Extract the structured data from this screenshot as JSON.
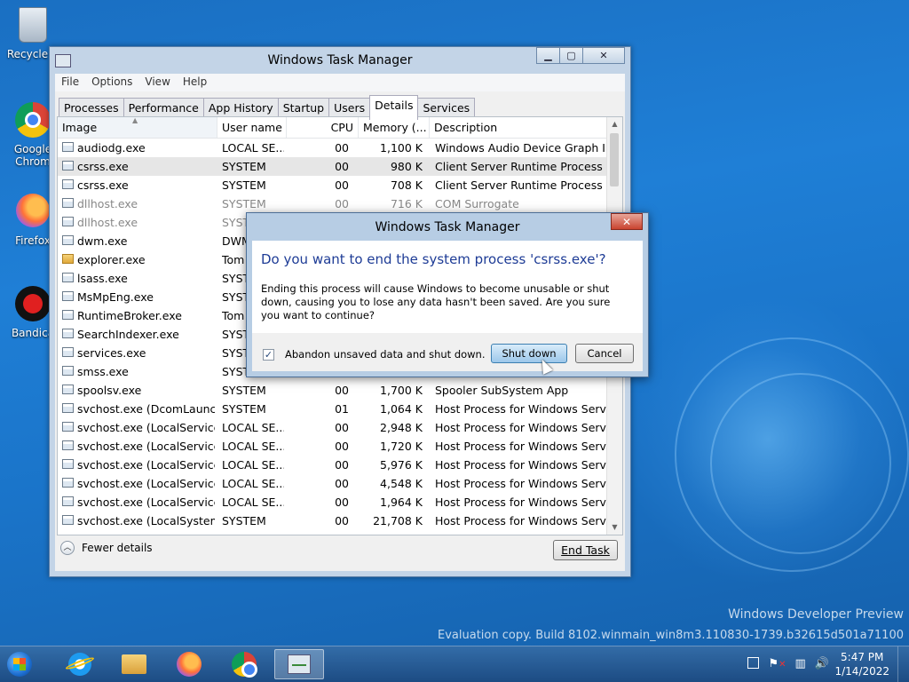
{
  "desktop": {
    "icons": [
      {
        "label": "Recycle B"
      },
      {
        "label": "Google Chrom"
      },
      {
        "label": "Firefox"
      },
      {
        "label": "Bandica"
      }
    ],
    "watermark_line1": "Windows Developer Preview",
    "watermark_line2": "Evaluation copy. Build 8102.winmain_win8m3.110830-1739.b32615d501a71100"
  },
  "task_manager": {
    "title": "Windows Task Manager",
    "caption": {
      "minimize": "▁",
      "maximize": "▢",
      "close": "✕"
    },
    "menu": [
      "File",
      "Options",
      "View",
      "Help"
    ],
    "tabs": [
      "Processes",
      "Performance",
      "App History",
      "Startup",
      "Users",
      "Details",
      "Services"
    ],
    "active_tab": "Details",
    "columns": {
      "image": "Image",
      "user": "User name",
      "cpu": "CPU",
      "memory": "Memory (...",
      "description": "Description"
    },
    "rows": [
      {
        "image": "audiodg.exe",
        "user": "LOCAL SE...",
        "cpu": "00",
        "memory": "1,100 K",
        "description": "Windows Audio Device Graph I..."
      },
      {
        "image": "csrss.exe",
        "user": "SYSTEM",
        "cpu": "00",
        "memory": "980 K",
        "description": "Client Server Runtime Process"
      },
      {
        "image": "csrss.exe",
        "user": "SYSTEM",
        "cpu": "00",
        "memory": "708 K",
        "description": "Client Server Runtime Process"
      },
      {
        "image": "dllhost.exe",
        "user": "SYSTEM",
        "cpu": "00",
        "memory": "716 K",
        "description": "COM Surrogate"
      },
      {
        "image": "dllhost.exe",
        "user": "SYST",
        "cpu": "",
        "memory": "",
        "description": ""
      },
      {
        "image": "dwm.exe",
        "user": "DWM",
        "cpu": "",
        "memory": "",
        "description": ""
      },
      {
        "image": "explorer.exe",
        "user": "Tom",
        "cpu": "",
        "memory": "",
        "description": ""
      },
      {
        "image": "lsass.exe",
        "user": "SYST",
        "cpu": "",
        "memory": "",
        "description": ""
      },
      {
        "image": "MsMpEng.exe",
        "user": "SYST",
        "cpu": "",
        "memory": "",
        "description": ""
      },
      {
        "image": "RuntimeBroker.exe",
        "user": "Tom",
        "cpu": "",
        "memory": "",
        "description": ""
      },
      {
        "image": "SearchIndexer.exe",
        "user": "SYST",
        "cpu": "",
        "memory": "",
        "description": ""
      },
      {
        "image": "services.exe",
        "user": "SYST",
        "cpu": "",
        "memory": "",
        "description": ""
      },
      {
        "image": "smss.exe",
        "user": "SYST",
        "cpu": "",
        "memory": "",
        "description": ""
      },
      {
        "image": "spoolsv.exe",
        "user": "SYSTEM",
        "cpu": "00",
        "memory": "1,700 K",
        "description": "Spooler SubSystem App"
      },
      {
        "image": "svchost.exe (DcomLaunch)",
        "user": "SYSTEM",
        "cpu": "01",
        "memory": "1,064 K",
        "description": "Host Process for Windows Serv..."
      },
      {
        "image": "svchost.exe (LocalService)",
        "user": "LOCAL SE...",
        "cpu": "00",
        "memory": "2,948 K",
        "description": "Host Process for Windows Serv..."
      },
      {
        "image": "svchost.exe (LocalService...",
        "user": "LOCAL SE...",
        "cpu": "00",
        "memory": "1,720 K",
        "description": "Host Process for Windows Serv..."
      },
      {
        "image": "svchost.exe (LocalService...",
        "user": "LOCAL SE...",
        "cpu": "00",
        "memory": "5,976 K",
        "description": "Host Process for Windows Serv..."
      },
      {
        "image": "svchost.exe (LocalService...",
        "user": "LOCAL SE...",
        "cpu": "00",
        "memory": "4,548 K",
        "description": "Host Process for Windows Serv..."
      },
      {
        "image": "svchost.exe (LocalService...",
        "user": "LOCAL SE...",
        "cpu": "00",
        "memory": "1,964 K",
        "description": "Host Process for Windows Serv..."
      },
      {
        "image": "svchost.exe (LocalSystem...",
        "user": "SYSTEM",
        "cpu": "00",
        "memory": "21,708 K",
        "description": "Host Process for Windows Serv..."
      }
    ],
    "selected_row": 1,
    "fewer_details": "Fewer details",
    "end_task": "End Task"
  },
  "dialog": {
    "title": "Windows Task Manager",
    "close": "✕",
    "heading": "Do you want to end the system process 'csrss.exe'?",
    "message": "Ending this process will cause Windows to become unusable or shut down, causing you to lose any data hasn't been saved. Are you sure you want to continue?",
    "checkbox_label": "Abandon unsaved data and shut down.",
    "checkbox_checked": true,
    "checkmark": "✓",
    "shutdown_button": "Shut down",
    "cancel_button": "Cancel"
  },
  "taskbar": {
    "time": "5:47 PM",
    "date": "1/14/2022",
    "tray_volume": "🔊",
    "tray_network": "▥"
  }
}
